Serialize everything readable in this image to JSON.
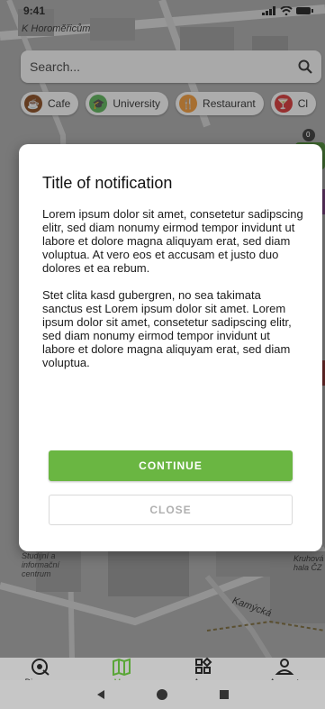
{
  "status_bar": {
    "time": "9:41"
  },
  "map": {
    "label_top": "K Horoměřicům",
    "label_kamycka": "Kamýcká",
    "label_studijni": "Studijní a informační centrum",
    "label_kruhova": "Kruhová hala ČZ",
    "badge": "0"
  },
  "search": {
    "placeholder": "Search..."
  },
  "chips": [
    {
      "label": "Cafe",
      "color": "#7a3d12",
      "icon": "C"
    },
    {
      "label": "University",
      "color": "#4ea34a",
      "icon": "U"
    },
    {
      "label": "Restaurant",
      "color": "#e08a2b",
      "icon": "R"
    },
    {
      "label": "Cl",
      "color": "#c62828",
      "icon": "Y"
    }
  ],
  "modal": {
    "title": "Title of notification",
    "paragraph1": "Lorem ipsum dolor sit amet, consetetur sadipscing elitr, sed diam nonumy eirmod tempor invidunt ut labore et dolore magna aliquyam erat, sed diam voluptua. At vero eos et accusam et justo duo dolores et ea rebum.",
    "paragraph2": "Stet clita kasd gubergren, no sea takimata sanctus est Lorem ipsum dolor sit amet. Lorem ipsum dolor sit amet, consetetur sadipscing elitr, sed diam nonumy eirmod tempor invidunt ut labore et dolore magna aliquyam erat, sed diam voluptua.",
    "continue_label": "CONTINUE",
    "close_label": "CLOSE"
  },
  "bottom_nav": [
    {
      "label": "Discover",
      "icon": "discover-icon"
    },
    {
      "label": "Map",
      "icon": "map-icon",
      "active": true
    },
    {
      "label": "Apps",
      "icon": "apps-icon"
    },
    {
      "label": "Account",
      "icon": "account-icon"
    }
  ],
  "colors": {
    "accent": "#6ab642",
    "active_nav": "#5aa637",
    "scrim": "#7d7d7d"
  }
}
